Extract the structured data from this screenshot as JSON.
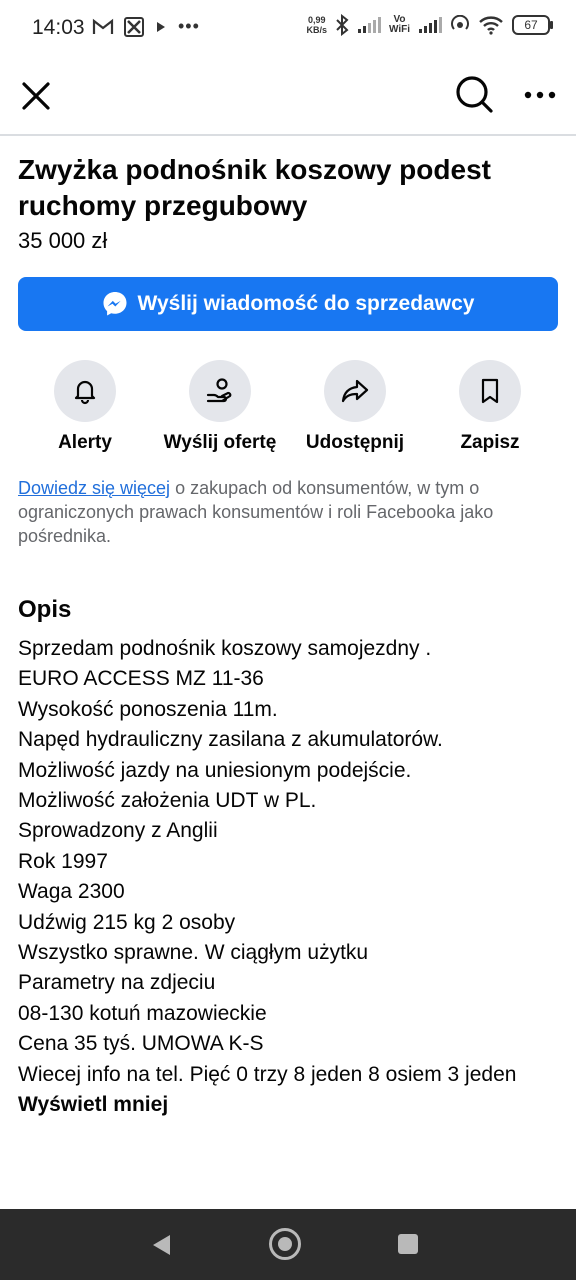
{
  "status_bar": {
    "time": "14:03",
    "net_speed_value": "0,99",
    "net_speed_unit": "KB/s",
    "vowifi_top": "Vo",
    "vowifi_bottom": "WiFi",
    "battery": "67"
  },
  "listing": {
    "title": "Zwyżka podnośnik koszowy podest ruchomy przegubowy",
    "price": "35 000 zł",
    "message_button": "Wyślij wiadomość do sprzedawcy"
  },
  "actions": [
    {
      "label": "Alerty",
      "icon": "bell-icon"
    },
    {
      "label": "Wyślij ofertę",
      "icon": "offer-hand-icon"
    },
    {
      "label": "Udostępnij",
      "icon": "share-icon"
    },
    {
      "label": "Zapisz",
      "icon": "bookmark-icon"
    }
  ],
  "info": {
    "link": "Dowiedz się więcej",
    "text": " o zakupach od konsumentów, w tym o ograniczonych prawach konsumentów i roli Facebooka jako pośrednika."
  },
  "description": {
    "heading": "Opis",
    "lines": [
      "Sprzedam podnośnik koszowy samojezdny .",
      "EURO ACCESS MZ 11-36",
      "Wysokość ponoszenia 11m.",
      "Napęd hydrauliczny zasilana z akumulatorów.",
      "Możliwość jazdy na uniesionym podejście.",
      "Możliwość założenia UDT w PL.",
      "Sprowadzony z Anglii",
      "Rok 1997",
      "Waga 2300",
      "Udźwig 215 kg 2 osoby",
      "Wszystko sprawne. W ciągłym użytku",
      "Parametry na zdjeciu",
      "08-130 kotuń mazowieckie",
      "Cena 35 tyś.  UMOWA K-S",
      "Wiecej info na tel. Pięć 0 trzy 8 jeden 8 osiem 3 jeden"
    ],
    "show_less": "Wyświetl mniej"
  },
  "colors": {
    "accent": "#1877f2",
    "link": "#216fdb",
    "icon_bg": "#e4e6eb",
    "sysnav_bg": "#2b2b2b"
  }
}
